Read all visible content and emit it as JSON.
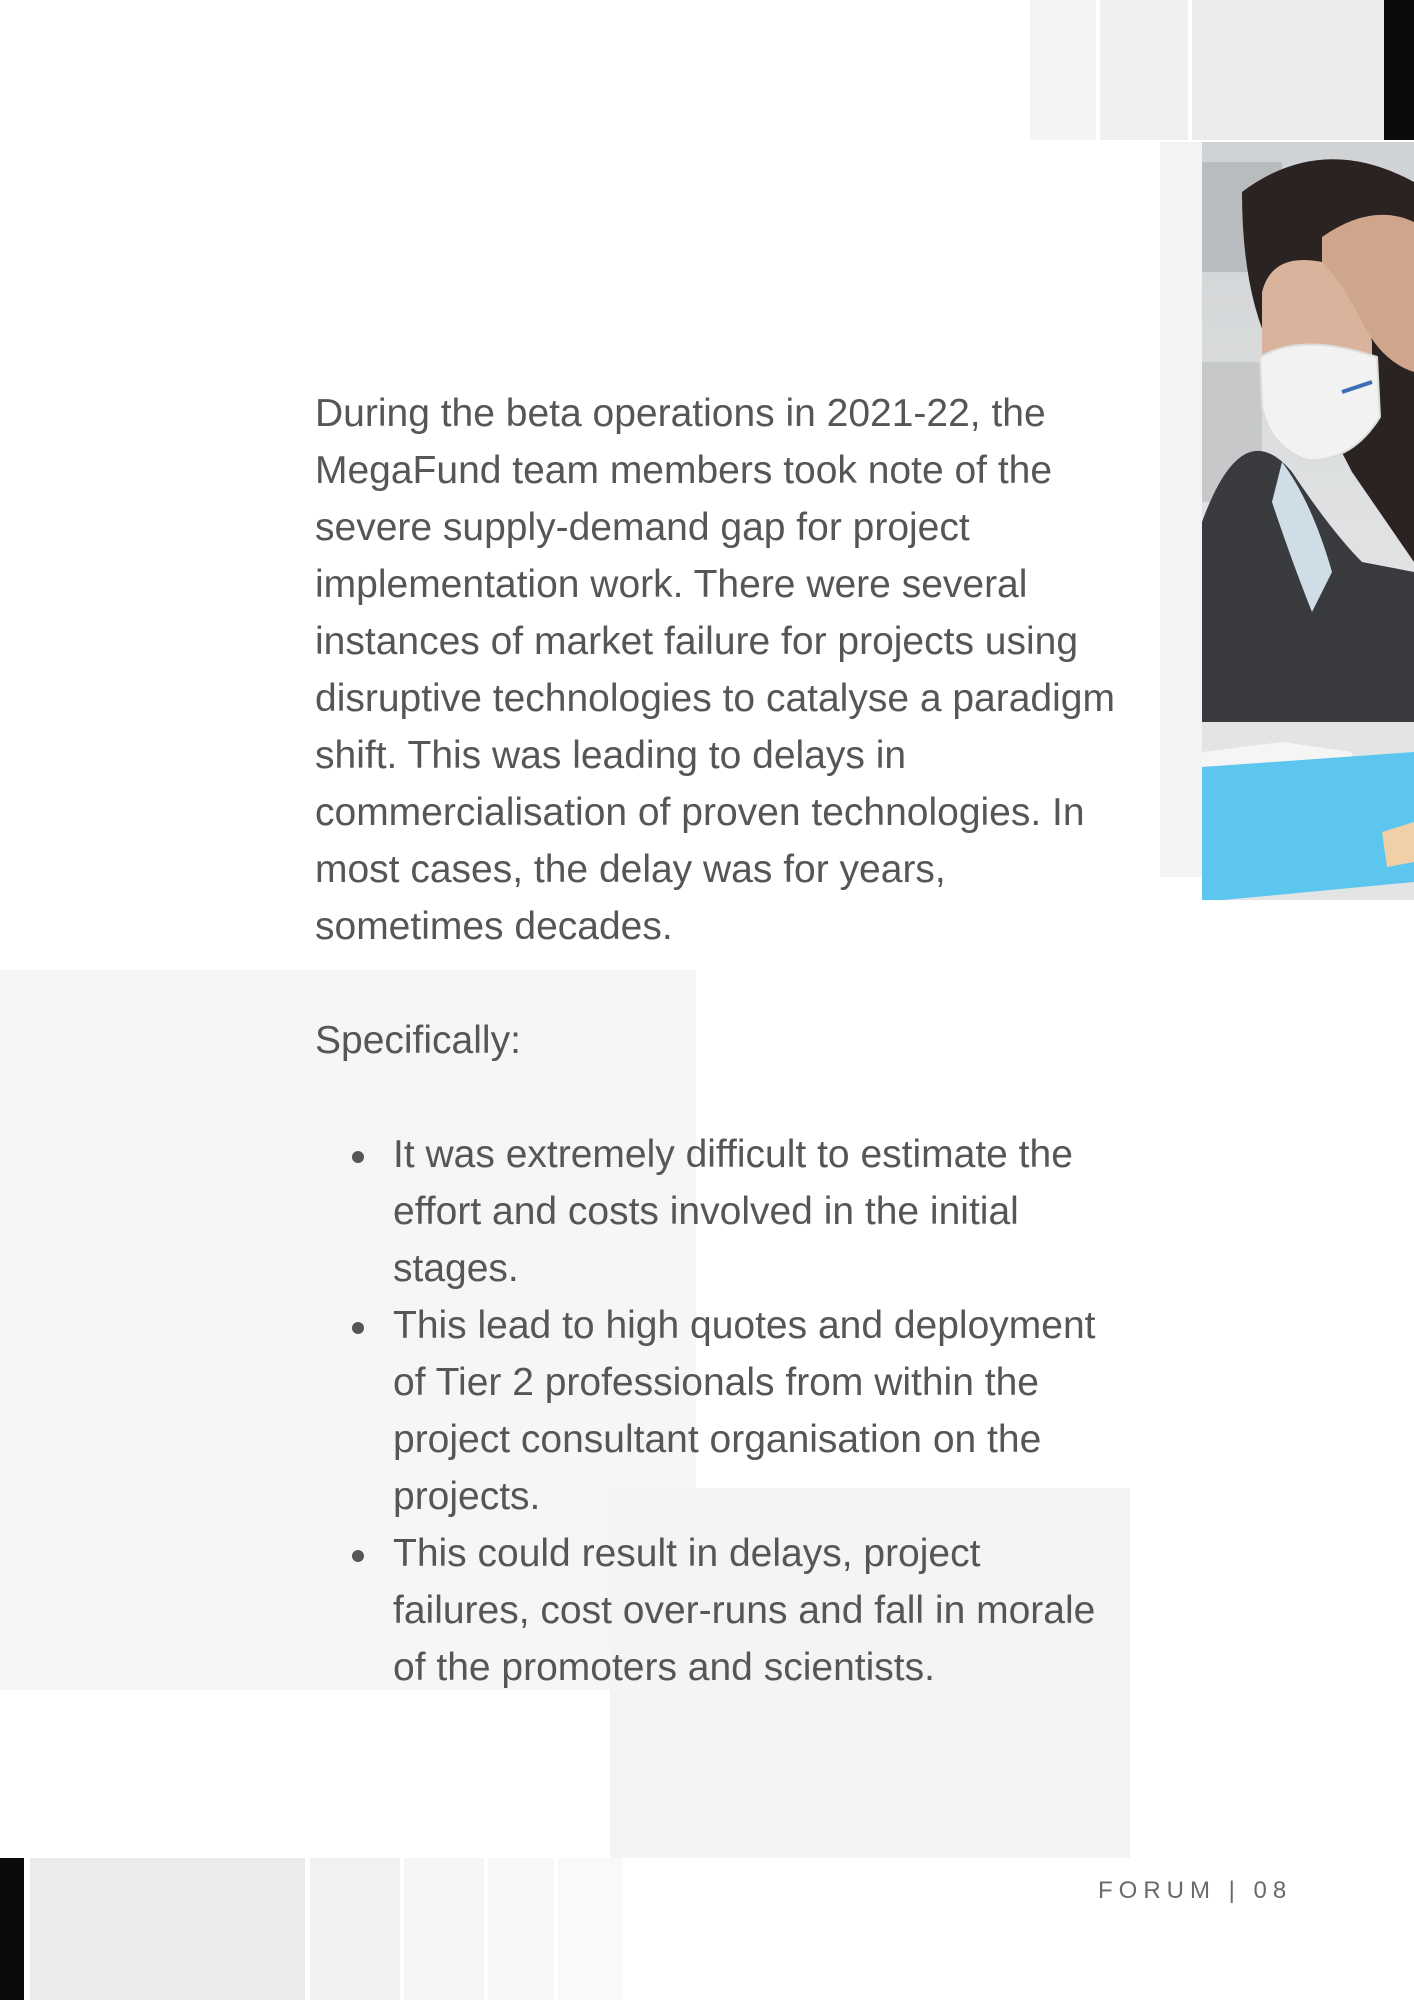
{
  "body": {
    "intro": "During the beta operations in 2021-22, the MegaFund team members took note of the severe supply-demand gap for project implementation work. There were several instances of market failure for projects using disruptive technologies to catalyse a paradigm shift.  This was leading to delays in commercialisation of proven technologies. In most cases, the delay was for years, sometimes decades.",
    "specifically_label": "Specifically:",
    "bullets": [
      "It was extremely difficult to estimate the effort and costs involved in the initial stages.",
      "This lead to high quotes and deployment of Tier 2 professionals from within the project consultant organisation on the projects.",
      "This could result in delays, project failures, cost over-runs and fall in morale of the promoters and scientists."
    ]
  },
  "footer": {
    "text": "FORUM | 08"
  },
  "colors": {
    "text": "#565656",
    "panel_left": "#f7f6f4",
    "panel_right": "#f4f4f4",
    "accent_black": "#0b0b0b",
    "folder_blue": "#5cc6ee"
  },
  "image": {
    "subject": "stressed-woman-with-face-mask-photo"
  }
}
